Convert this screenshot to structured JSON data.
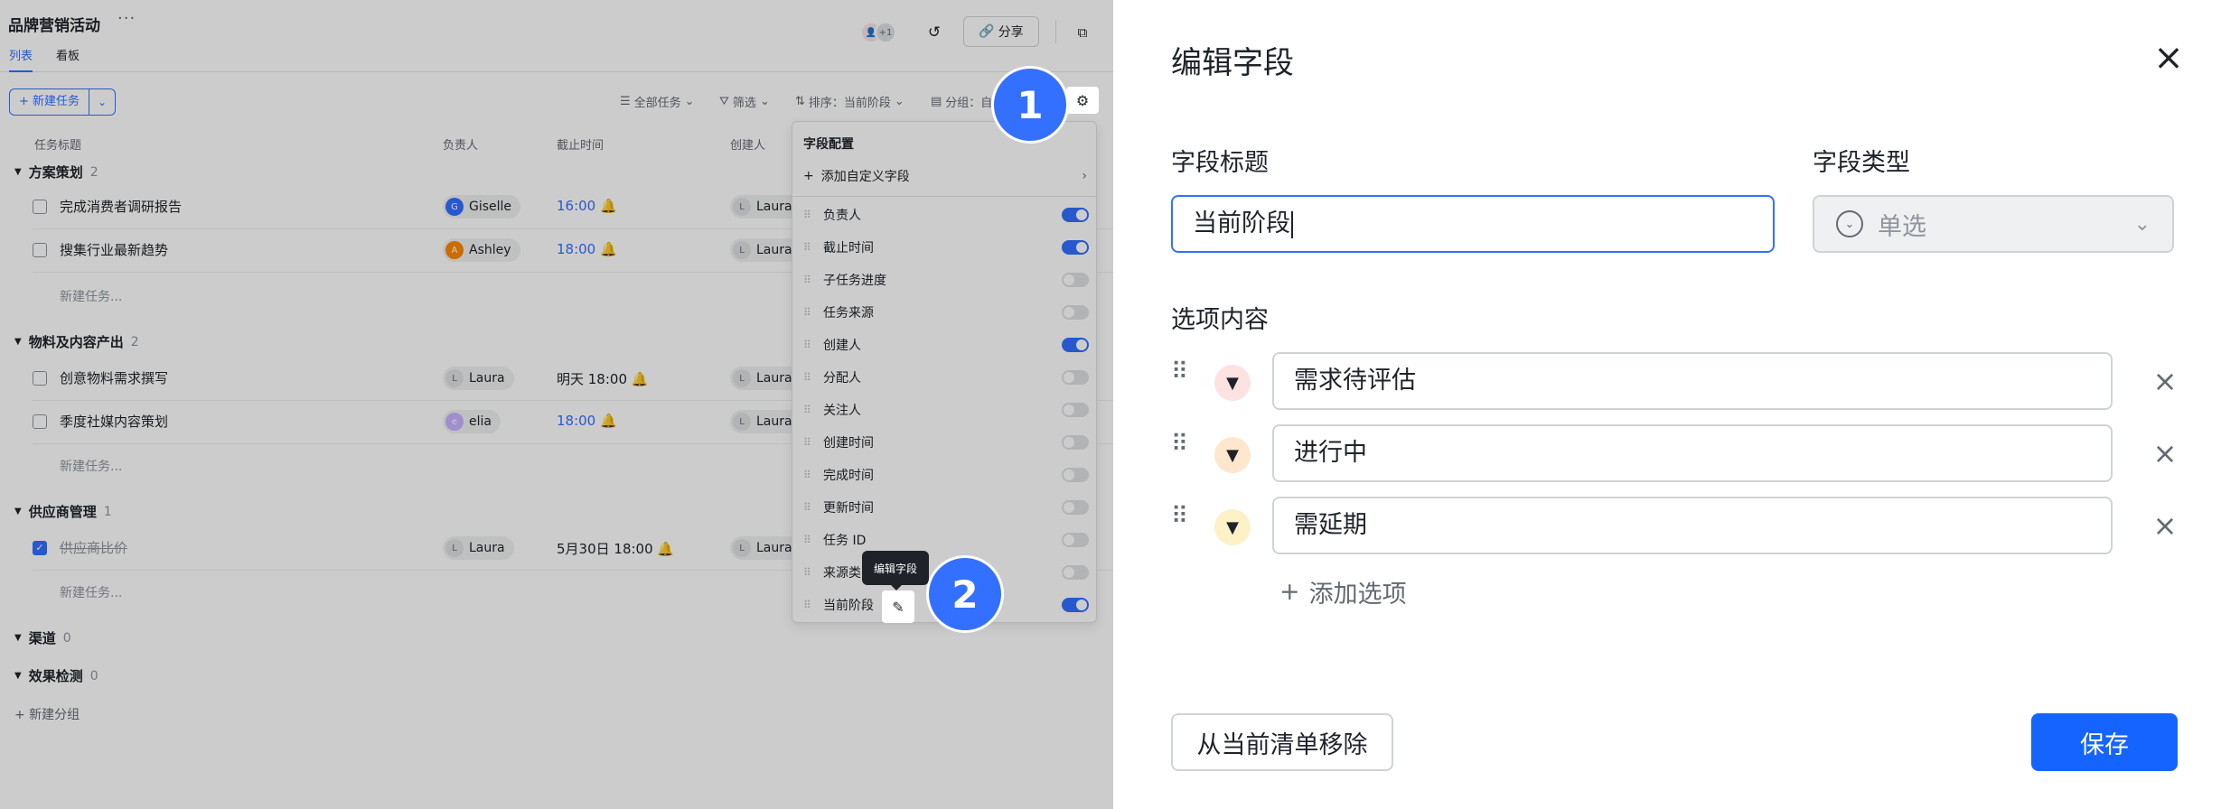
{
  "project": {
    "title": "品牌营销活动",
    "more": "···"
  },
  "tabs": [
    {
      "label": "列表"
    },
    {
      "label": "看板"
    }
  ],
  "header": {
    "share_label": "分享",
    "avatar_extra": "+1"
  },
  "toolbar": {
    "new_task": "+ 新建任务",
    "all_tasks": "全部任务",
    "filter": "筛选",
    "sort": "排序：当前阶段",
    "group": "分组：自"
  },
  "columns": {
    "title": "任务标题",
    "assignee": "负责人",
    "due": "截止时间",
    "creator": "创建人"
  },
  "groups": [
    {
      "name": "方案策划",
      "count": "2"
    },
    {
      "name": "物料及内容产出",
      "count": "2"
    },
    {
      "name": "供应商管理",
      "count": "1"
    },
    {
      "name": "渠道",
      "count": "0"
    },
    {
      "name": "效果检测",
      "count": "0"
    }
  ],
  "tasks": [
    {
      "title": "完成消费者调研报告",
      "assignee": "Giselle",
      "due": "16:00",
      "creator": "Laura"
    },
    {
      "title": "搜集行业最新趋势",
      "assignee": "Ashley",
      "due": "18:00",
      "creator": "Laura"
    },
    {
      "title": "创意物料需求撰写",
      "assignee": "Laura",
      "due": "明天 18:00",
      "creator": "Laura"
    },
    {
      "title": "季度社媒内容策划",
      "assignee": "elia",
      "due": "18:00",
      "creator": "Laura"
    },
    {
      "title": "供应商比价",
      "assignee": "Laura",
      "due": "5月30日 18:00",
      "creator": "Laura"
    }
  ],
  "new_task_row": "新建任务...",
  "new_group": "+ 新建分组",
  "field_panel": {
    "title": "字段配置",
    "add_custom": "添加自定义字段",
    "fields": [
      {
        "label": "负责人",
        "on": true
      },
      {
        "label": "截止时间",
        "on": true
      },
      {
        "label": "子任务进度",
        "on": false
      },
      {
        "label": "任务来源",
        "on": false
      },
      {
        "label": "创建人",
        "on": true
      },
      {
        "label": "分配人",
        "on": false
      },
      {
        "label": "关注人",
        "on": false
      },
      {
        "label": "创建时间",
        "on": false
      },
      {
        "label": "完成时间",
        "on": false
      },
      {
        "label": "更新时间",
        "on": false
      },
      {
        "label": "任务 ID",
        "on": false
      },
      {
        "label": "来源类",
        "on": false
      },
      {
        "label": "当前阶段",
        "on": true
      }
    ],
    "tooltip": "编辑字段"
  },
  "markers": {
    "m1": "1",
    "m2": "2"
  },
  "modal": {
    "title": "编辑字段",
    "field_title_label": "字段标题",
    "field_title_value": "当前阶段",
    "field_type_label": "字段类型",
    "field_type_value": "单选",
    "options_label": "选项内容",
    "options": [
      {
        "text": "需求待评估",
        "color": "#fde2e2"
      },
      {
        "text": "进行中",
        "color": "#fee7cd"
      },
      {
        "text": "需延期",
        "color": "#fdf1c7"
      }
    ],
    "add_option": "添加选项",
    "remove_label": "从当前清单移除",
    "save_label": "保存"
  },
  "colors": {
    "accent": "#3370ff",
    "save": "#1664ff"
  },
  "icons": [
    "more-icon",
    "history-icon",
    "link-icon",
    "popout-icon",
    "settings-icon",
    "bell-icon",
    "edit-icon",
    "close-icon",
    "drag-icon",
    "chevron-down-icon",
    "plus-icon"
  ]
}
